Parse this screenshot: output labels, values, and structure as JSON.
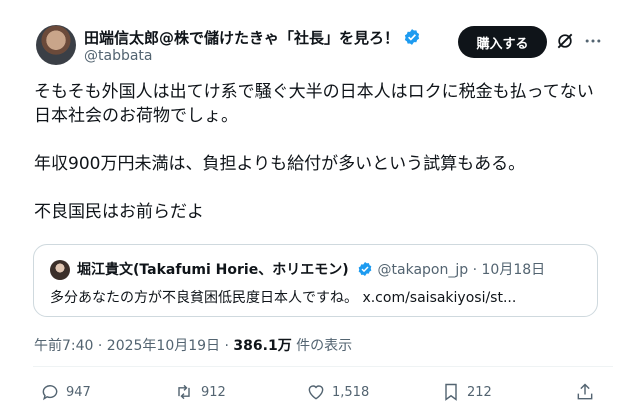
{
  "author": {
    "name": "田端信太郎@株で儲けたきゃ「社長」を見ろ！",
    "handle": "@tabbata"
  },
  "header": {
    "buy_label": "購入する"
  },
  "tweet": {
    "line1": "そもそも外国人は出てけ系で騒ぐ大半の日本人はロクに税金も払ってない",
    "line2": "日本社会のお荷物でしょ。",
    "line3": "年収900万円未満は、負担よりも給付が多いという試算もある。",
    "line4": "不良国民はお前らだよ"
  },
  "quote": {
    "name": "堀江貴文(Takafumi Horie、ホリエモン)",
    "handle": "@takapon_jp",
    "separator": "·",
    "date": "10月18日",
    "text": "多分あなたの方が不良貧困低民度日本人ですね。 x.com/saisakiyosi/st..."
  },
  "meta": {
    "time": "午前7:40 · 2025年10月19日 · ",
    "views": "386.1万",
    "views_label": " 件の表示"
  },
  "actions": {
    "replies": "947",
    "reposts": "912",
    "likes": "1,518",
    "bookmarks": "212"
  },
  "colors": {
    "accent": "#1d9bf0",
    "text": "#0f1419",
    "muted": "#536471"
  }
}
